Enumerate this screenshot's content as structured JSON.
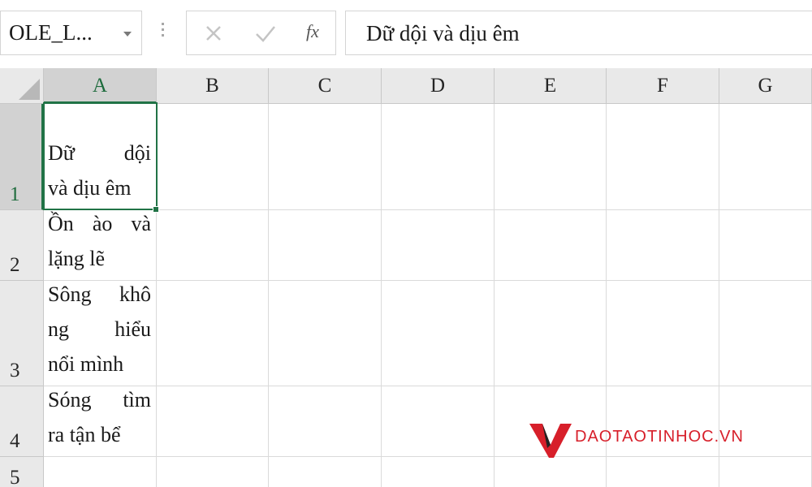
{
  "formula_bar": {
    "name_box": "OLE_L...",
    "fx_label": "fx",
    "formula_value": "Dữ dội và dịu êm"
  },
  "columns": [
    "A",
    "B",
    "C",
    "D",
    "E",
    "F",
    "G"
  ],
  "selected_column": "A",
  "rows": [
    {
      "number": "1",
      "a_lines": [
        "Dữ dội",
        "và dịu êm"
      ],
      "a_split": [
        [
          "Dữ",
          "dội"
        ],
        null
      ]
    },
    {
      "number": "2",
      "a_lines": [
        "Ồn ào và",
        "lặng lẽ"
      ]
    },
    {
      "number": "3",
      "a_lines": [
        "Sông khô",
        "ng hiểu",
        "nổi mình"
      ]
    },
    {
      "number": "4",
      "a_lines": [
        "Sóng tìm",
        "ra tận bể"
      ]
    },
    {
      "number": "5",
      "a_lines": []
    }
  ],
  "selected_row": "1",
  "selected_cell": "A1",
  "watermark": {
    "text": "DAOTAOTINHOC.VN",
    "color": "#d71f2a"
  },
  "accent_color": "#217346"
}
